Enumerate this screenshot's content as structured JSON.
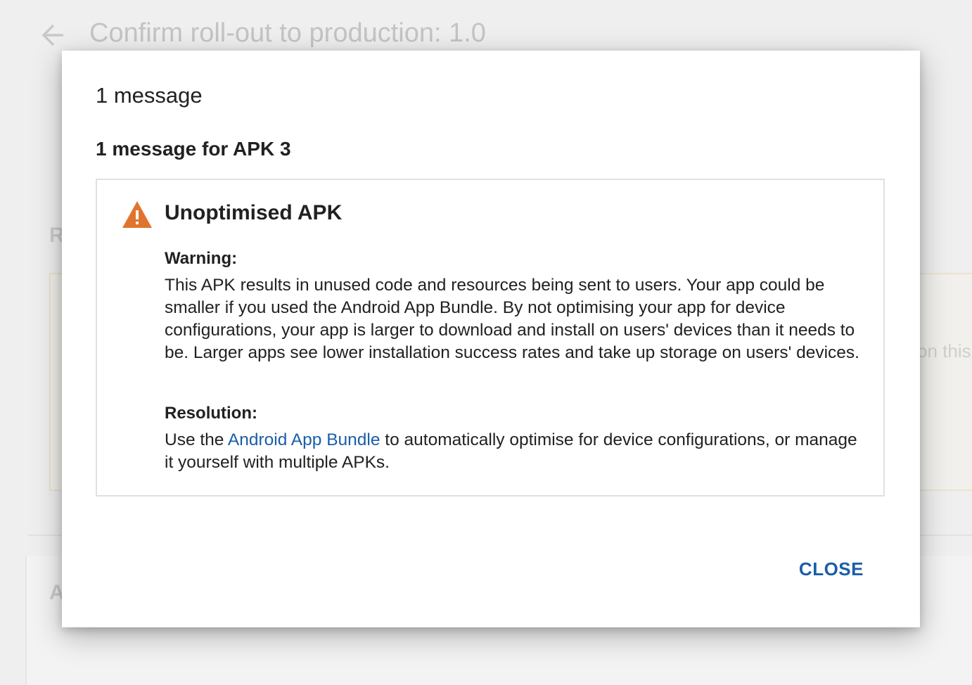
{
  "background": {
    "title": "Confirm roll-out to production: 1.0",
    "section_letter_1": "R",
    "section_letter_2": "A",
    "card_partial_text": "on this"
  },
  "dialog": {
    "title": "1 message",
    "subheading": "1 message for APK 3",
    "card": {
      "icon": "warning-icon",
      "icon_color": "#e0742e",
      "title": "Unoptimised APK",
      "warning_label": "Warning:",
      "warning_text": "This APK results in unused code and resources being sent to users. Your app could be smaller if you used the Android App Bundle. By not optimising your app for device configurations, your app is larger to download and install on users' devices than it needs to be. Larger apps see lower installation success rates and take up storage on users' devices.",
      "resolution_label": "Resolution:",
      "resolution_prefix": "Use the ",
      "resolution_link": "Android App Bundle",
      "resolution_suffix": " to automatically optimise for device configurations, or manage it yourself with multiple APKs."
    },
    "close_label": "CLOSE",
    "accent_color": "#1a5ea8"
  }
}
